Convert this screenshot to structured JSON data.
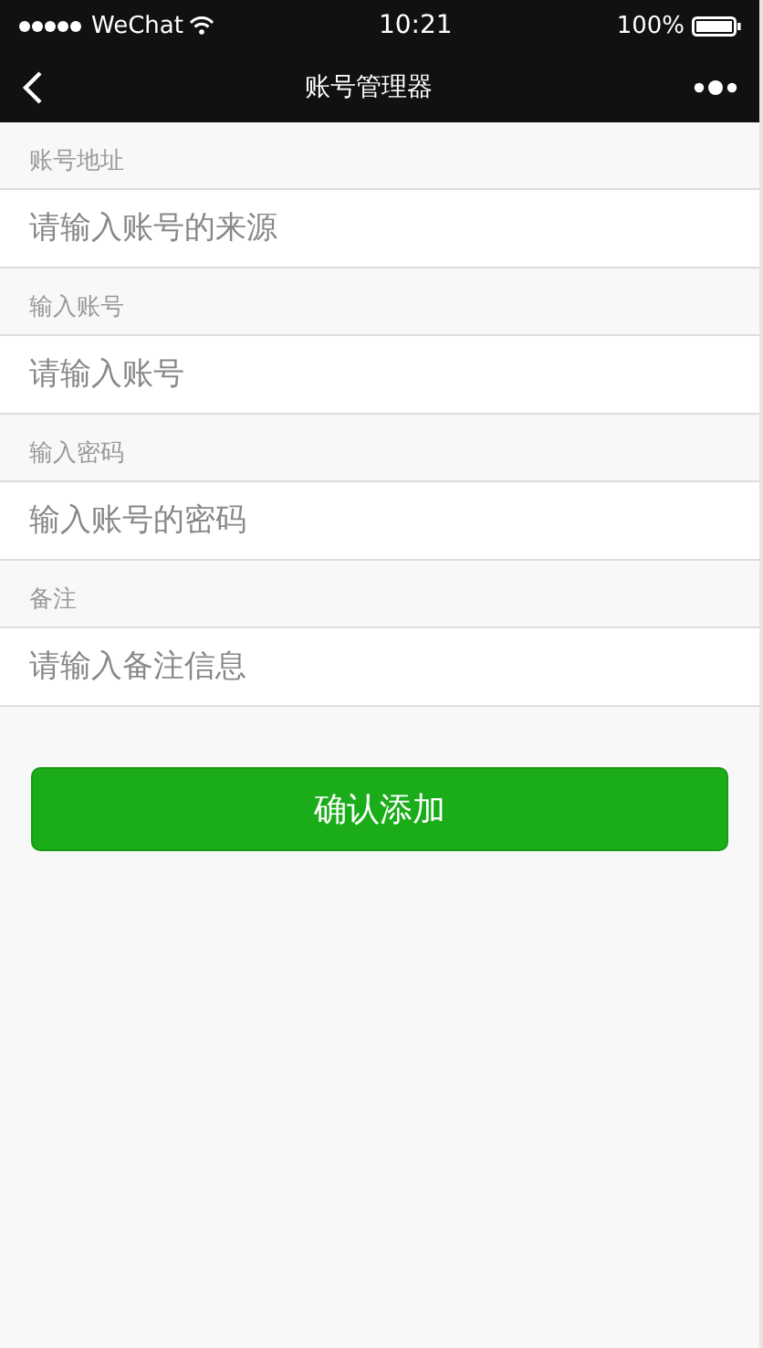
{
  "status_bar": {
    "carrier": "WeChat",
    "time": "10:21",
    "battery": "100%"
  },
  "nav": {
    "title": "账号管理器"
  },
  "fields": [
    {
      "label": "账号地址",
      "placeholder": "请输入账号的来源"
    },
    {
      "label": "输入账号",
      "placeholder": "请输入账号"
    },
    {
      "label": "输入密码",
      "placeholder": "输入账号的密码"
    },
    {
      "label": "备注",
      "placeholder": "请输入备注信息"
    }
  ],
  "submit_button": "确认添加"
}
